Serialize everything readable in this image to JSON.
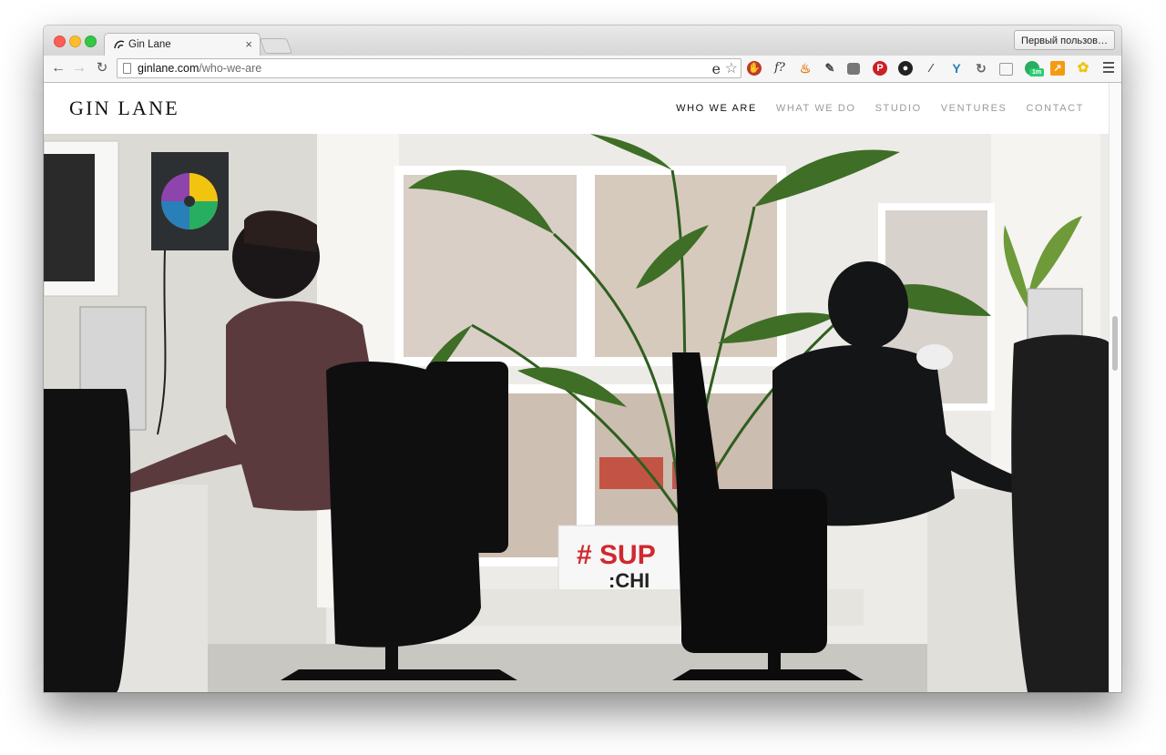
{
  "browser": {
    "tab_title": "Gin Lane",
    "tab_close": "×",
    "profile_label": "Первый пользов…",
    "url_host": "ginlane.com",
    "url_path": "/who-we-are",
    "nav": {
      "back": "←",
      "forward": "→",
      "reload": "↻"
    },
    "omnibox_icons": [
      "ie-icon",
      "star-icon"
    ],
    "extension_icons": [
      "adblock-icon",
      "font-icon",
      "flame-icon",
      "evernote-icon",
      "pocket-icon",
      "pinterest-icon",
      "camera-icon",
      "eyedropper-icon",
      "y-icon",
      "refresh-icon",
      "reader-icon",
      "chat-icon",
      "chart-icon",
      "puzzle-icon"
    ],
    "extension_badge": "1m",
    "colors": {
      "close_red": "#fc5f57",
      "minimize_yellow": "#fdbc2e",
      "zoom_green": "#33c748"
    }
  },
  "site": {
    "logo": "GIN LANE",
    "nav": [
      {
        "label": "WHO WE ARE",
        "active": true
      },
      {
        "label": "WHAT WE DO",
        "active": false
      },
      {
        "label": "STUDIO",
        "active": false
      },
      {
        "label": "VENTURES",
        "active": false
      },
      {
        "label": "CONTACT",
        "active": false
      }
    ],
    "hero_sign": {
      "line1": "# SUP",
      "line2": ":CHI"
    }
  }
}
